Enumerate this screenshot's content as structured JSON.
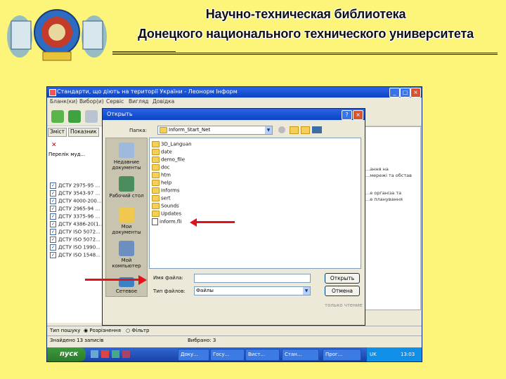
{
  "slide": {
    "title_line1": "Научно-техническая библиотека",
    "title_line2": "Донецкого национального технического университета",
    "emblem_icon": "university-emblem-icon",
    "bg_color": "#fdf57a",
    "arrow_color": "#e4101a"
  },
  "app": {
    "title": "Стандарти, що діють на території України - Леонорм Інформ",
    "minimize": "_",
    "maximize": "□",
    "close": "×",
    "menu": [
      "Бланк(ки)",
      "Вибор(и)",
      "Сервіс",
      "Вигляд",
      "Довідка"
    ],
    "left_tabs": [
      "Зміст",
      "Показник"
    ],
    "left_header": "Перелік муд...",
    "list_items": [
      "ДСТУ 2975-95 ...",
      "ДСТУ 3543-97 ...",
      "ДСТУ 4000-200...",
      "ДСТУ 2965-94 ...",
      "ДСТУ 3375-96 ...",
      "ДСТУ 4386-20(1...",
      "ДСТУ ISO 5072...",
      "ДСТУ ISO 5072...",
      "ДСТУ ISO 1990...",
      "ДСТУ ISO 1548..."
    ],
    "right_lines": [
      "...ання на",
      "...мережі та обстав",
      "...е організа та",
      "...е планування"
    ],
    "status_filter_label": "Тип пошуку",
    "status_option1": "Розрізнення",
    "status_option2": "Фільтр",
    "status_found": "Знайдено 13 записів",
    "status_selected": "Вибрано: 3",
    "taskbar": {
      "start": "пуск",
      "items": [
        "Доку...",
        "Госу...",
        "Вист...",
        "Стан...",
        "Прог..."
      ],
      "tray_lang": "UK",
      "clock": "13:03"
    }
  },
  "dialog": {
    "title": "Открыть",
    "help": "?",
    "close": "×",
    "lookin_label": "Папка:",
    "lookin_value": "Inform_Start_Net",
    "places": [
      "Недавние документы",
      "Рабочий стол",
      "Мои документы",
      "Мой компьютер",
      "Сетевое"
    ],
    "files": [
      {
        "name": "3D_Languan",
        "type": "folder"
      },
      {
        "name": "date",
        "type": "folder"
      },
      {
        "name": "demo_file",
        "type": "folder"
      },
      {
        "name": "doc",
        "type": "folder"
      },
      {
        "name": "htm",
        "type": "folder"
      },
      {
        "name": "help",
        "type": "folder"
      },
      {
        "name": "Informs",
        "type": "folder"
      },
      {
        "name": "sert",
        "type": "folder"
      },
      {
        "name": "Sounds",
        "type": "folder"
      },
      {
        "name": "Updates",
        "type": "folder"
      },
      {
        "name": "inform.fli",
        "type": "file"
      }
    ],
    "filename_label": "Имя файла:",
    "filename_value": "",
    "filetype_label": "Тип файлов:",
    "filetype_value": "Файлы",
    "open_button": "Открыть",
    "cancel_button": "Отмена",
    "readonly_label": "только чтение"
  }
}
